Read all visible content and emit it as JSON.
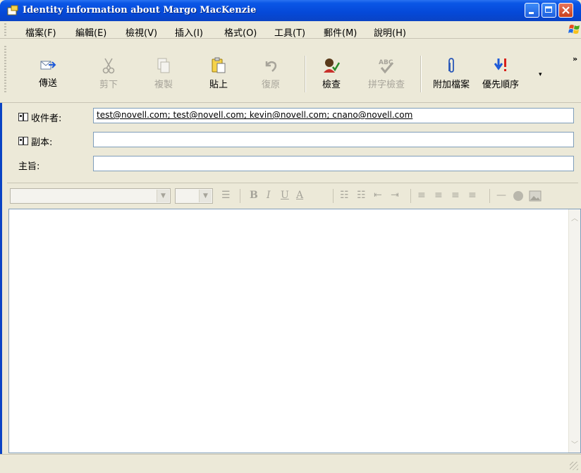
{
  "window": {
    "title": "Identity information about Margo MacKenzie"
  },
  "menu": {
    "items": [
      "檔案(F)",
      "編輯(E)",
      "檢視(V)",
      "插入(I)",
      "格式(O)",
      "工具(T)",
      "郵件(M)",
      "說明(H)"
    ]
  },
  "toolbar": {
    "send": "傳送",
    "cut": "剪下",
    "copy": "複製",
    "paste": "貼上",
    "undo": "復原",
    "check": "檢查",
    "spell": "拼字檢查",
    "attach": "附加檔案",
    "priority": "優先順序",
    "overflow": "»",
    "spell_icon_text": "ABC"
  },
  "fields": {
    "to_label": "收件者:",
    "to_value": "test@novell.com; test@novell.com; kevin@novell.com; cnano@novell.com",
    "cc_label": "副本:",
    "cc_value": "",
    "subject_label": "主旨:",
    "subject_value": ""
  },
  "format_toolbar": {
    "bold": "B",
    "italic": "I",
    "underline": "U",
    "font_color": "A"
  },
  "colors": {
    "titlebar": "#0a56e6",
    "chrome": "#ece9d8",
    "input_border": "#7f9db9"
  }
}
